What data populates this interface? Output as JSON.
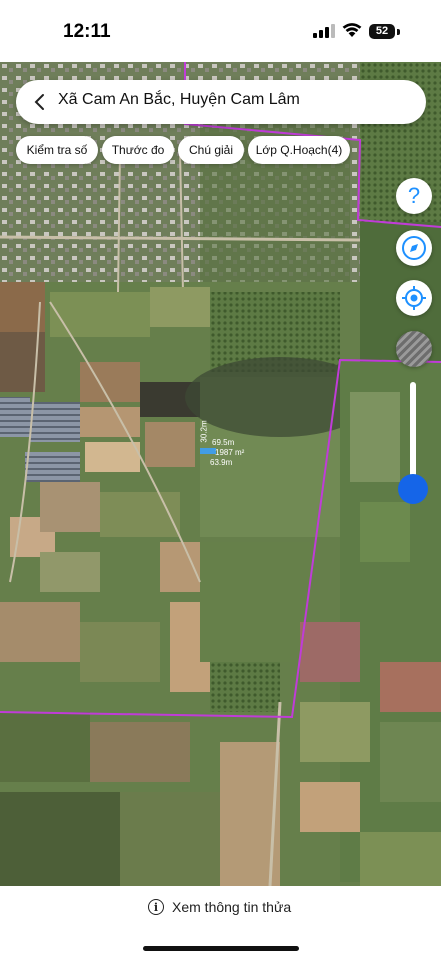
{
  "status_bar": {
    "time": "12:11",
    "battery": "52"
  },
  "search": {
    "title": "Xã Cam An Bắc, Huyện Cam Lâm"
  },
  "chips": [
    {
      "label": "Kiểm tra số"
    },
    {
      "label": "Thước đo"
    },
    {
      "label": "Chú giải"
    },
    {
      "label": "Lớp Q.Hoạch(4)"
    }
  ],
  "map_controls": {
    "help_glyph": "?",
    "help_icon": "help-icon",
    "compass_icon": "compass-icon",
    "locate_icon": "locate-icon",
    "layer_icon": "satellite-layer-icon",
    "zoom_level": 0.15
  },
  "parcel_labels": {
    "side_left": "30.2m",
    "side_a": "69.5m",
    "area": "1987 m²",
    "side_b": "63.9m"
  },
  "colors": {
    "boundary": "#c03cd8",
    "accent": "#1565e8",
    "parcel": "#3aa0ff"
  },
  "bottom": {
    "info_text": "Xem thông tin thửa",
    "info_glyph": "i"
  }
}
